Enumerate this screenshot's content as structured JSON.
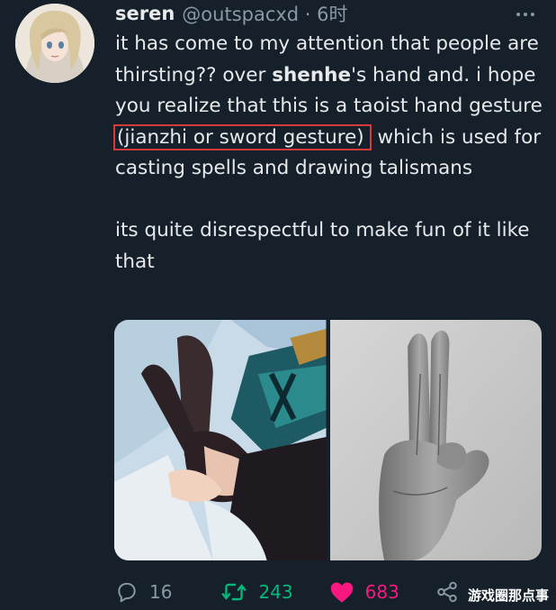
{
  "tweet": {
    "author_name": "seren",
    "handle_time": "@outspacxd · 6时",
    "para1": {
      "seg1": "it has come to my attention that people are thirsting?? over ",
      "bold": "shenhe",
      "seg2": "'s hand and. i hope you realize that this is a taoist hand gesture ",
      "highlight": "(jianzhi or sword gesture)",
      "seg3": " which is used for casting spells and drawing talismans"
    },
    "para2": "its quite disrespectful to make fun of it like that"
  },
  "actions": {
    "replies": "16",
    "retweets": "243",
    "likes": "683"
  },
  "watermark": "游戏圈那点事",
  "colors": {
    "background": "#15202b",
    "text": "#e7e9ea",
    "muted": "#8b98a5",
    "retweet": "#00ba7c",
    "like": "#f91880",
    "highlight_box": "#d83a3a"
  },
  "icons": [
    "more-icon",
    "reply-icon",
    "retweet-icon",
    "heart-icon",
    "share-icon"
  ]
}
